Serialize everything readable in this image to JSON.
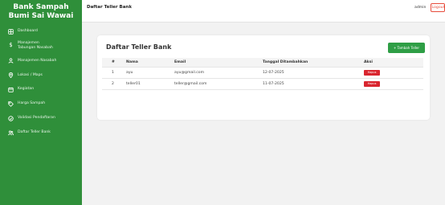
{
  "sidebar": {
    "brand_line1": "Bank Sampah",
    "brand_line2": "Bumi Sai Wawai",
    "items": [
      {
        "label": "Dashboard",
        "icon": "grid-icon"
      },
      {
        "label": "Manajemen Tabungan Nasabah",
        "icon": "dollar-icon"
      },
      {
        "label": "Manajemen Nasabah",
        "icon": "user-icon"
      },
      {
        "label": "Lokasi / Maps",
        "icon": "map-pin-icon"
      },
      {
        "label": "Kegiatan",
        "icon": "calendar-icon"
      },
      {
        "label": "Harga Sampah",
        "icon": "tags-icon"
      },
      {
        "label": "Validasi Pendaftaran",
        "icon": "check-circle-icon"
      },
      {
        "label": "Daftar Teller Bank",
        "icon": "users-icon"
      }
    ]
  },
  "header": {
    "title": "Daftar Teller Bank",
    "user": "admin",
    "logout_label": "Logout"
  },
  "main": {
    "card_title": "Daftar Teller Bank",
    "add_button_label": "+ Tambah Teller",
    "table": {
      "columns": [
        "#",
        "Nama",
        "Email",
        "Tanggal Ditambahkan",
        "Aksi"
      ],
      "rows": [
        {
          "no": "1",
          "name": "ayu",
          "email": "ayu@gmail.com",
          "date": "12-07-2025",
          "action": "Hapus"
        },
        {
          "no": "2",
          "name": "teller01",
          "email": "teller@gmail.com",
          "date": "11-07-2025",
          "action": "Hapus"
        }
      ]
    }
  },
  "colors": {
    "sidebar": "#2f8f3a",
    "primary_button": "#2e9e45",
    "danger": "#d9252f",
    "logout": "#e74c3c"
  }
}
